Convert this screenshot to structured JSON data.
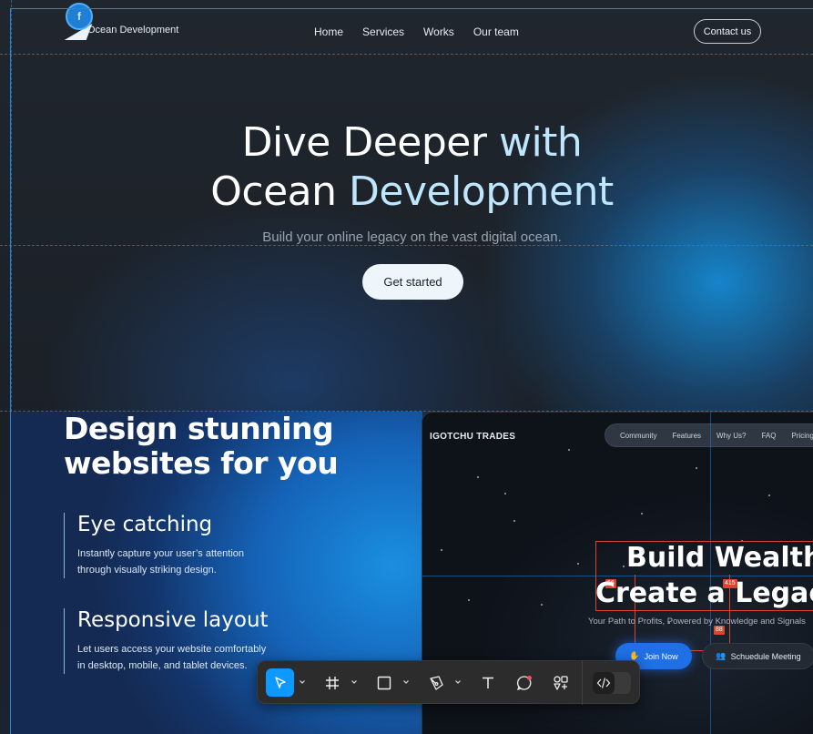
{
  "site": {
    "fig_badge": "f",
    "logo_text": "Ocean Development",
    "nav": [
      "Home",
      "Services",
      "Works",
      "Our team"
    ],
    "contact_label": "Contact us"
  },
  "hero": {
    "title_line1_a": "Dive Deeper ",
    "title_line1_b": "with",
    "title_line2_a": "Ocean ",
    "title_line2_b": "Development",
    "subtitle": "Build your online legacy on the vast digital ocean.",
    "cta_label": "Get started"
  },
  "design": {
    "title_line1": "Design stunning",
    "title_line2": "websites for you",
    "features": [
      {
        "title": "Eye catching",
        "desc_line1": "Instantly capture your user’s attention",
        "desc_line2": "through visually striking design."
      },
      {
        "title": "Responsive layout",
        "desc_line1": "Let users access your website comfortably",
        "desc_line2": "in desktop, mobile, and tablet devices."
      }
    ]
  },
  "preview": {
    "brand": "IGOTCHU TRADES",
    "nav": [
      "Community",
      "Features",
      "Why Us?",
      "FAQ",
      "Pricing"
    ],
    "title_line1": "Build Wealth",
    "title_line2": "Create a Legacy",
    "subtitle": "Your Path to Profits, Powered by Knowledge and Signals",
    "join_label": "Join Now",
    "schedule_label": "Schuedule Meeting",
    "measure_tags": [
      "66",
      "415",
      "88"
    ]
  },
  "colors": {
    "selection": "#1e88e5",
    "toolbar_active": "#0d99ff",
    "measure_red": "#d9452f",
    "cta_bg": "#eef5fb"
  },
  "toolbar": {
    "tools": [
      "move-tool",
      "frame-tool",
      "shape-tool",
      "pen-tool",
      "text-tool",
      "comment-tool",
      "actions-tool",
      "dev-mode-toggle"
    ]
  }
}
